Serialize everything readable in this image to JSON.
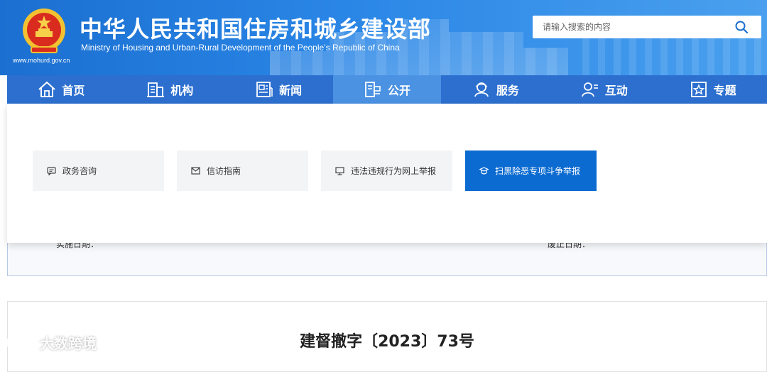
{
  "header": {
    "title": "中华人民共和国住房和城乡建设部",
    "subtitle": "Ministry of Housing and Urban-Rural Development of the People’s Republic of China",
    "url": "www.mohurd.gov.cn",
    "emblem_icon": "national-emblem-icon"
  },
  "search": {
    "placeholder": "请输入搜索的内容",
    "icon": "search-icon"
  },
  "nav": {
    "items": [
      {
        "label": "首页",
        "icon": "home-icon",
        "active": false
      },
      {
        "label": "机构",
        "icon": "building-icon",
        "active": false
      },
      {
        "label": "新闻",
        "icon": "news-icon",
        "active": false
      },
      {
        "label": "公开",
        "icon": "disclosure-icon",
        "active": true
      },
      {
        "label": "服务",
        "icon": "service-icon",
        "active": false
      },
      {
        "label": "互动",
        "icon": "interaction-icon",
        "active": false
      },
      {
        "label": "专题",
        "icon": "topic-icon",
        "active": false
      }
    ]
  },
  "dropdown": {
    "items": [
      {
        "label": "政务咨询",
        "icon": "chat-icon",
        "highlight": false
      },
      {
        "label": "信访指南",
        "icon": "mail-icon",
        "highlight": false
      },
      {
        "label": "违法违规行为网上举报",
        "icon": "monitor-icon",
        "highlight": false
      },
      {
        "label": "扫黑除恶专项斗争举报",
        "icon": "shield-icon",
        "highlight": true
      }
    ]
  },
  "info": {
    "impl_date_label": "实施日期：",
    "abolish_date_label": "废止日期："
  },
  "document": {
    "number": "建督撤字〔2023〕73号"
  },
  "watermark": {
    "text": "大数跨境",
    "icon": "watermark-logo-icon"
  },
  "colors": {
    "header_blue": "#1b6fd0",
    "nav_blue": "#2c6fcf",
    "nav_active": "#4b92e3",
    "highlight_blue": "#0b6bd1"
  }
}
